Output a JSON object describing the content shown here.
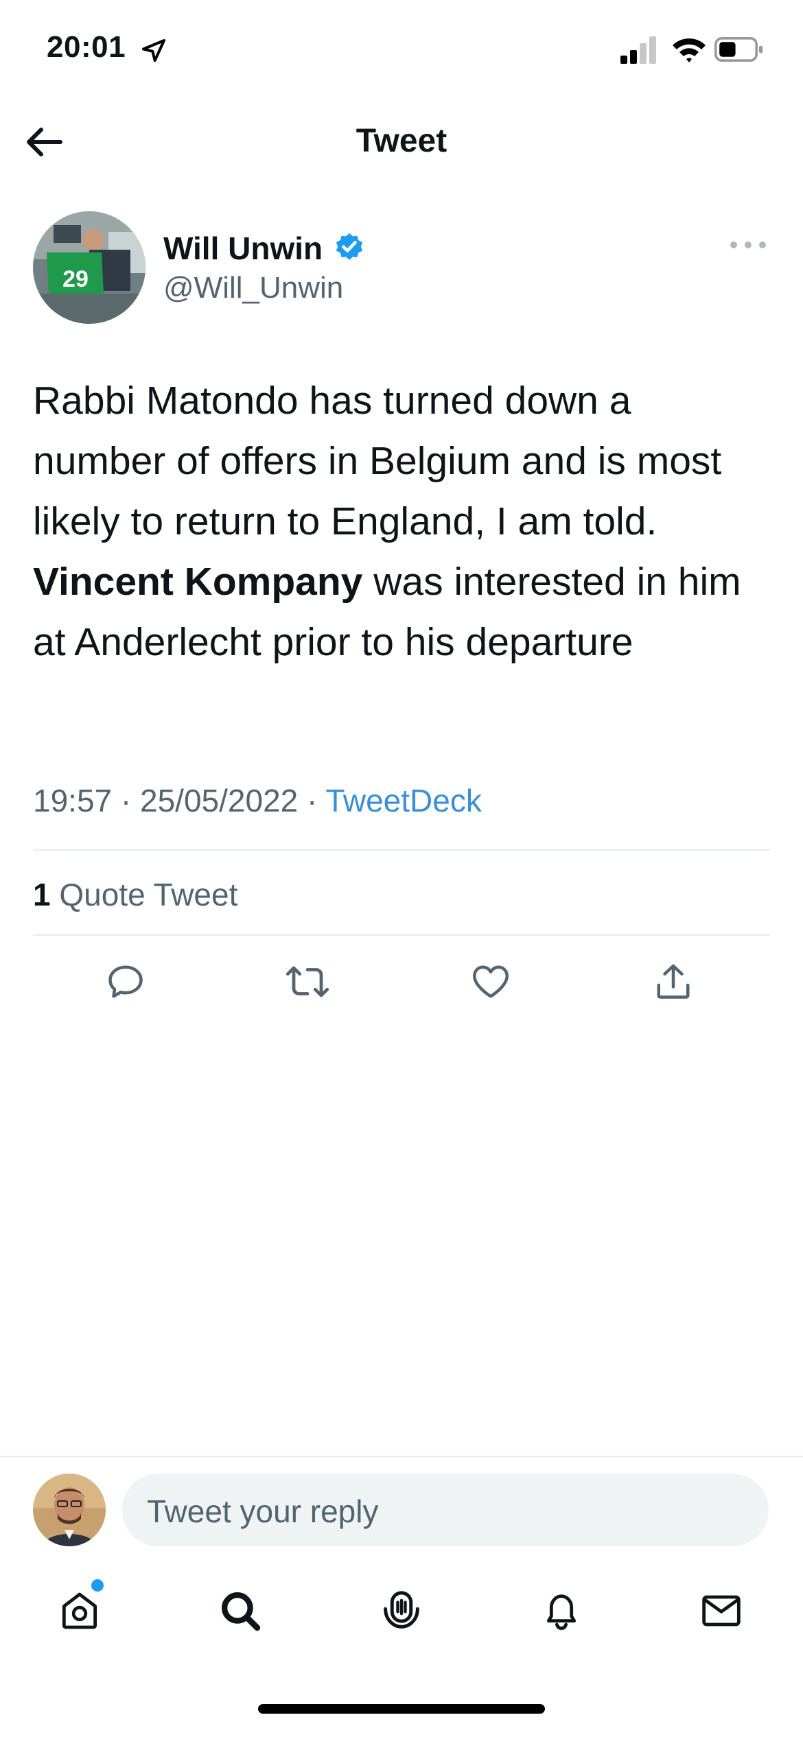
{
  "status_bar": {
    "time": "20:01",
    "icons": [
      "location-arrow-icon",
      "cellular-signal-icon",
      "wifi-icon",
      "battery-icon"
    ]
  },
  "header": {
    "title": "Tweet",
    "back_icon": "back-arrow-icon"
  },
  "tweet": {
    "author": {
      "name": "Will Unwin",
      "handle": "@Will_Unwin",
      "verified": true,
      "avatar_jersey_number": "29"
    },
    "text_before": "Rabbi Matondo has turned down a number of offers in Belgium and is most likely to return to England, I am told. ",
    "text_bold": "Vincent Kompany",
    "text_after": " was interested in him at Anderlecht prior to his departure",
    "time": "19:57",
    "date": "25/05/2022",
    "separator": " · ",
    "source": "TweetDeck",
    "quote_count": "1",
    "quote_label": " Quote Tweet"
  },
  "actions": [
    "reply-icon",
    "retweet-icon",
    "like-icon",
    "share-icon"
  ],
  "reply_bar": {
    "placeholder": "Tweet your reply"
  },
  "tab_bar": {
    "tabs": [
      "home-icon",
      "search-icon",
      "spaces-icon",
      "notifications-icon",
      "messages-icon"
    ],
    "home_has_notification": true
  },
  "colors": {
    "accent": "#1d9bf0",
    "text": "#0f1419",
    "secondary": "#536471",
    "divider": "#e6ecf0",
    "reply_bg": "#eff3f4"
  }
}
